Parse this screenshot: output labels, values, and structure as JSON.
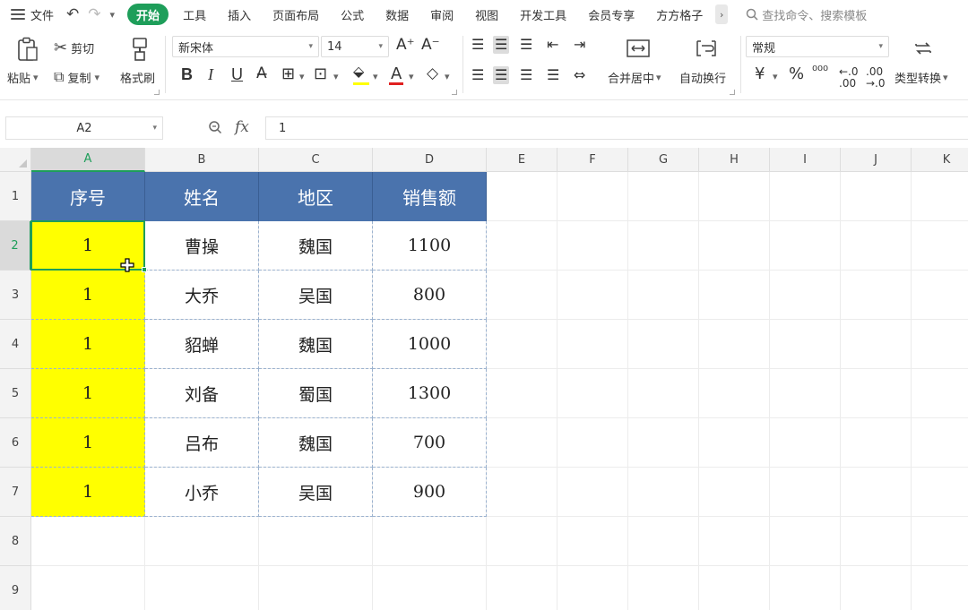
{
  "menubar": {
    "file_label": "文件",
    "tabs": [
      {
        "label": "开始",
        "active": true
      },
      {
        "label": "工具"
      },
      {
        "label": "插入"
      },
      {
        "label": "页面布局"
      },
      {
        "label": "公式"
      },
      {
        "label": "数据"
      },
      {
        "label": "审阅"
      },
      {
        "label": "视图"
      },
      {
        "label": "开发工具"
      },
      {
        "label": "会员专享"
      },
      {
        "label": "方方格子"
      }
    ],
    "search_placeholder": "查找命令、搜索模板"
  },
  "ribbon": {
    "paste_label": "粘贴",
    "cut_label": "剪切",
    "copy_label": "复制",
    "format_painter_label": "格式刷",
    "font_name": "新宋体",
    "font_size": "14",
    "merge_center_label": "合并居中",
    "wrap_text_label": "自动换行",
    "number_format": "常规",
    "type_convert_label": "类型转换",
    "accent_color": "#1e9e5a",
    "highlight_color": "#ffff00",
    "font_color": "#e02020"
  },
  "formula_bar": {
    "cell_ref": "A2",
    "formula_value": "1",
    "fx_label": "fx"
  },
  "sheet": {
    "columns": [
      "A",
      "B",
      "C",
      "D",
      "E",
      "F",
      "G",
      "H",
      "I",
      "J",
      "K"
    ],
    "rows": [
      "1",
      "2",
      "3",
      "4",
      "5",
      "6",
      "7",
      "8",
      "9"
    ],
    "selected_cell": "A2",
    "header_fill": "#4a73ad",
    "highlight_fill": "#ffff00",
    "table": {
      "headers": [
        "序号",
        "姓名",
        "地区",
        "销售额"
      ],
      "rows": [
        [
          "1",
          "曹操",
          "魏国",
          "1100"
        ],
        [
          "1",
          "大乔",
          "吴国",
          "800"
        ],
        [
          "1",
          "貂蝉",
          "魏国",
          "1000"
        ],
        [
          "1",
          "刘备",
          "蜀国",
          "1300"
        ],
        [
          "1",
          "吕布",
          "魏国",
          "700"
        ],
        [
          "1",
          "小乔",
          "吴国",
          "900"
        ]
      ]
    }
  }
}
